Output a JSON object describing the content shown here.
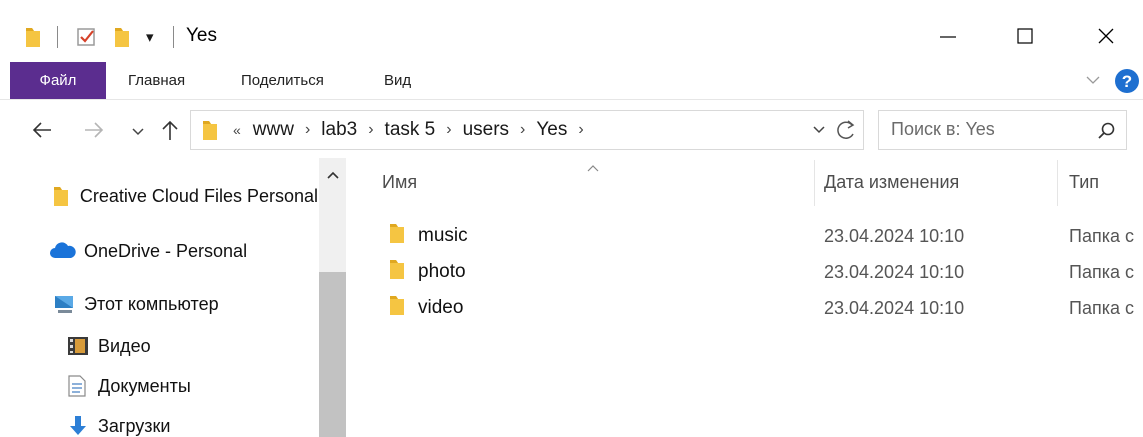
{
  "window": {
    "title": "Yes",
    "quick_access_dropdown": "▾"
  },
  "ribbon": {
    "tabs": [
      {
        "label": "Файл",
        "active": true
      },
      {
        "label": "Главная"
      },
      {
        "label": "Поделиться"
      },
      {
        "label": "Вид"
      }
    ],
    "accent_color": "#5b2d8f"
  },
  "address": {
    "overflow": "«",
    "crumbs": [
      "www",
      "lab3",
      "task 5",
      "users",
      "Yes"
    ]
  },
  "search": {
    "placeholder": "Поиск в: Yes"
  },
  "nav_pane": {
    "items": [
      {
        "label": "Creative Cloud Files Personal",
        "icon": "folder-icon"
      },
      {
        "label": "OneDrive - Personal",
        "icon": "cloud-icon"
      },
      {
        "label": "Этот компьютер",
        "icon": "computer-icon"
      },
      {
        "label": "Видео",
        "icon": "video-icon"
      },
      {
        "label": "Документы",
        "icon": "documents-icon"
      },
      {
        "label": "Загрузки",
        "icon": "download-icon"
      }
    ]
  },
  "file_list": {
    "columns": [
      "Имя",
      "Дата изменения",
      "Тип"
    ],
    "rows": [
      {
        "name": "music",
        "date": "23.04.2024 10:10",
        "type": "Папка с"
      },
      {
        "name": "photo",
        "date": "23.04.2024 10:10",
        "type": "Папка с"
      },
      {
        "name": "video",
        "date": "23.04.2024 10:10",
        "type": "Папка с"
      }
    ]
  }
}
